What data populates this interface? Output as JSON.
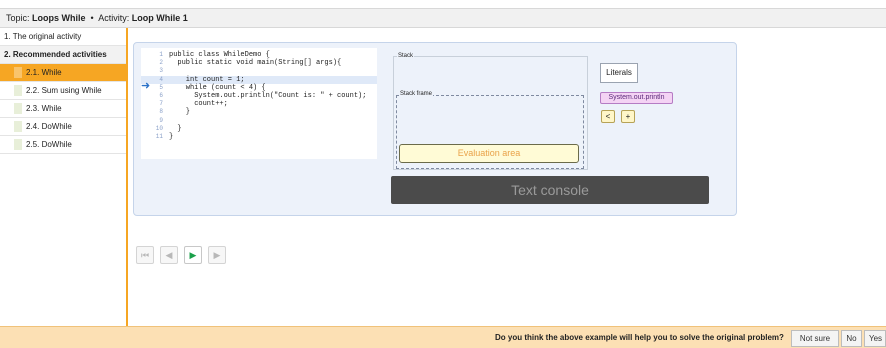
{
  "topic_bar": {
    "topic_label": "Topic:",
    "topic_value": "Loops While",
    "separator": "•",
    "activity_label": "Activity:",
    "activity_value": "Loop While 1"
  },
  "sidebar": {
    "items": [
      {
        "label": "1. The original activity"
      },
      {
        "label": "2. Recommended activities"
      },
      {
        "label": "2.1. While"
      },
      {
        "label": "2.2. Sum using While"
      },
      {
        "label": "2.3. While"
      },
      {
        "label": "2.4. DoWhile"
      },
      {
        "label": "2.5. DoWhile"
      }
    ]
  },
  "code": {
    "lines": [
      {
        "n": "1",
        "text": "public class WhileDemo {"
      },
      {
        "n": "2",
        "text": "  public static void main(String[] args){"
      },
      {
        "n": "3",
        "text": ""
      },
      {
        "n": "4",
        "text": "    int count = 1;"
      },
      {
        "n": "5",
        "text": "    while (count < 4) {"
      },
      {
        "n": "6",
        "text": "      System.out.println(\"Count is: \" + count);"
      },
      {
        "n": "7",
        "text": "      count++;"
      },
      {
        "n": "8",
        "text": "    }"
      },
      {
        "n": "9",
        "text": ""
      },
      {
        "n": "10",
        "text": "  }"
      },
      {
        "n": "11",
        "text": "}"
      }
    ],
    "current_line": "4"
  },
  "visualizer": {
    "stack_label": "Stack",
    "frame_label": "Stack frame",
    "evaluation_label": "Evaluation area",
    "literals_label": "Literals",
    "literal_items": [
      "System.out.println",
      "<",
      "+"
    ],
    "console_label": "Text console"
  },
  "nav": {
    "first": "⏮",
    "prev": "◀",
    "play": "▶",
    "next": "▶"
  },
  "feedback": {
    "question": "Do you think the above example will help you to solve the original problem?",
    "answers": [
      "Not sure",
      "No",
      "Yes"
    ]
  },
  "colors": {
    "accent": "#f6a623",
    "panel": "#edf2fa",
    "console": "#4b4b4b"
  }
}
